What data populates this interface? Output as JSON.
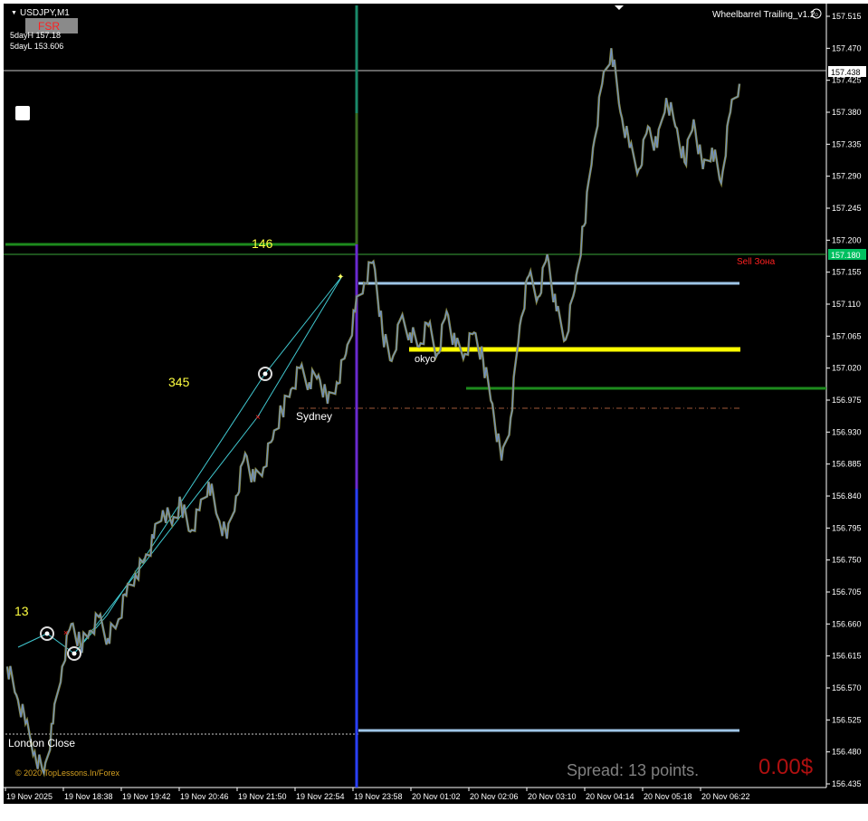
{
  "header": {
    "symbol": "USDJPY,M1",
    "fsr_label": "FSR",
    "five_day_high": "5dayH 157.18",
    "five_day_low": "5dayL 153.606",
    "indicator_name": "Wheelbarrel Trailing_v1.2"
  },
  "labels": {
    "count_146": "146",
    "count_345": "345",
    "count_13": "13",
    "sydney": "Sydney",
    "tokyo": "okyo",
    "london_close": "London Close",
    "sell_zone": "Sell Зона",
    "copyright": "© 2020 TopLessons.In/Forex",
    "spread": "Spread: 13 points.",
    "profit": "0.00$"
  },
  "colors": {
    "background": "#000000",
    "price_line": "#6f8fc4",
    "price_line_alt": "#8a8a3a",
    "green_level": "#1d8a1d",
    "yellow_level": "#ffff00",
    "light_blue_level": "#9fc6e8",
    "session_line": "#2020ff",
    "sell_zone_text": "#ff2020",
    "ask_badge": "#00c060",
    "profit_text": "#b01010",
    "spread_text": "#808080"
  },
  "chart_data": {
    "type": "line",
    "title": "USDJPY,M1",
    "x_tick_labels": [
      "19 Nov 2025",
      "19 Nov 18:38",
      "19 Nov 19:42",
      "19 Nov 20:46",
      "19 Nov 21:50",
      "19 Nov 22:54",
      "19 Nov 23:58",
      "20 Nov 01:02",
      "20 Nov 02:06",
      "20 Nov 03:10",
      "20 Nov 04:14",
      "20 Nov 05:18",
      "20 Nov 06:22"
    ],
    "y_tick_labels": [
      "157.515",
      "157.470",
      "157.425",
      "157.380",
      "157.335",
      "157.290",
      "157.245",
      "157.200",
      "157.155",
      "157.110",
      "157.065",
      "157.020",
      "156.975",
      "156.930",
      "156.885",
      "156.840",
      "156.795",
      "156.750",
      "156.705",
      "156.660",
      "156.615",
      "156.570",
      "156.525",
      "156.480",
      "156.435"
    ],
    "ylim": [
      156.435,
      157.515
    ],
    "current_price": "157.438",
    "ask_price": "157.180",
    "levels": [
      {
        "name": "bid",
        "value": 157.438
      },
      {
        "name": "ask",
        "value": 157.18
      },
      {
        "name": "five-day-high",
        "value": 157.18
      },
      {
        "name": "upper-light-blue",
        "value": 157.14
      },
      {
        "name": "yellow",
        "value": 157.04
      },
      {
        "name": "lower-green",
        "value": 156.99
      },
      {
        "name": "dash-dot",
        "value": 156.965
      },
      {
        "name": "lower-light-blue",
        "value": 156.51
      },
      {
        "name": "london-close-dotted",
        "value": 156.505
      }
    ],
    "series": [
      {
        "values": [
          156.6,
          156.56,
          156.52,
          156.48,
          156.45,
          156.52,
          156.6,
          156.66,
          156.63,
          156.65,
          156.67,
          156.64,
          156.66,
          156.7,
          156.73,
          156.75,
          156.78,
          156.82,
          156.8,
          156.83,
          156.79,
          156.82,
          156.86,
          156.81,
          156.78,
          156.84,
          156.9,
          156.86,
          156.88,
          156.92,
          156.96,
          156.99,
          157.02,
          157.0,
          157.01,
          156.97,
          157.0,
          157.04,
          157.1,
          157.14,
          157.17,
          157.07,
          157.03,
          157.09,
          157.07,
          157.05,
          157.08,
          157.04,
          157.1,
          157.05,
          157.04,
          157.07,
          157.03,
          156.97,
          156.89,
          156.95,
          157.08,
          157.15,
          157.12,
          157.18,
          157.1,
          157.06,
          157.13,
          157.22,
          157.33,
          157.42,
          157.47,
          157.38,
          157.33,
          157.3,
          157.36,
          157.33,
          157.4,
          157.36,
          157.31,
          157.37,
          157.3,
          157.33,
          157.28,
          157.38,
          157.42
        ]
      }
    ]
  }
}
